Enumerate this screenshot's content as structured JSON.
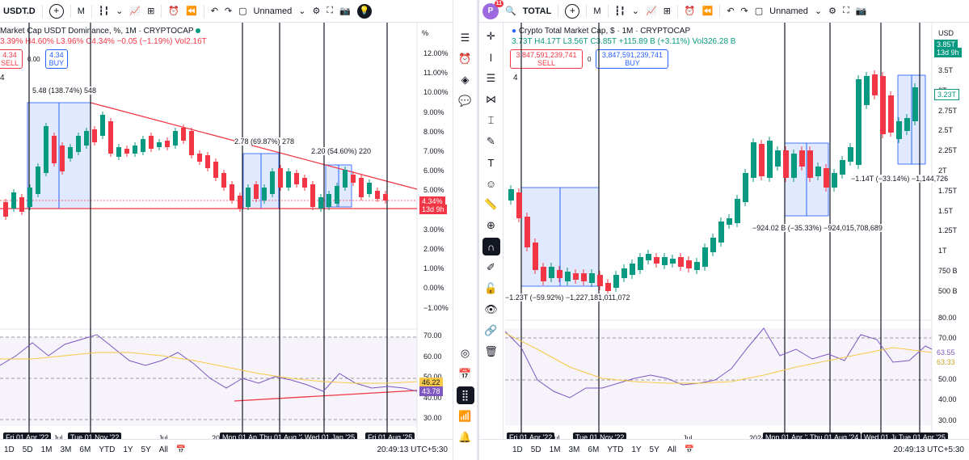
{
  "left": {
    "topbar": {
      "symbol": "USDT.D",
      "interval": "M",
      "layout_name": "Unnamed"
    },
    "legend": {
      "title": "Market Cap USDT Dominance, %",
      "interval": "1M",
      "exchange": "CRYPTOCAP",
      "values": [
        "3.39%",
        "H4.60%",
        "L3.96%",
        "C4.34%",
        "−0.05 (−1.19%)",
        "Vol2.16T"
      ]
    },
    "trade": {
      "sell_price": "4.34",
      "sell_label": "SELL",
      "spread": "0.00",
      "buy_price": "4.34",
      "buy_label": "BUY"
    },
    "indicator_count": "4",
    "price_axis_unit": "%",
    "price_axis": [
      "12.00%",
      "11.00%",
      "10.00%",
      "9.00%",
      "8.00%",
      "7.00%",
      "6.00%",
      "5.00%",
      "4.00%",
      "3.00%",
      "2.00%",
      "1.00%",
      "0.00%",
      "−1.00%"
    ],
    "current_price": "4.34%",
    "countdown": "13d 9h",
    "rsi_axis": [
      "70.00",
      "60.00",
      "50.00",
      "40.00",
      "30.00"
    ],
    "rsi_tags": {
      "ma": "46.22",
      "rsi": "43.78"
    },
    "measures": [
      {
        "label": "5.48 (138.74%) 548"
      },
      {
        "label": "2.78 (69.87%) 278"
      },
      {
        "label": "2.20 (54.60%) 220"
      }
    ],
    "time_labels": [
      "Jul",
      "Jul",
      "20"
    ],
    "time_pills": [
      "Fri 01 Apr '22",
      "Tue 01 Nov '22",
      "Mon 01 Apr",
      "Thu 01 Aug '2",
      "Wed 01 Jan '25",
      "Fri 01 Aug '25"
    ],
    "ranges": [
      "1D",
      "5D",
      "1M",
      "3M",
      "6M",
      "YTD",
      "1Y",
      "5Y",
      "All"
    ]
  },
  "right": {
    "topbar": {
      "avatar_letter": "P",
      "avatar_badge": "11",
      "symbol": "TOTAL",
      "interval": "M",
      "layout_name": "Unnamed"
    },
    "legend": {
      "title": "Crypto Total Market Cap, $",
      "interval": "1M",
      "exchange": "CRYPTOCAP",
      "values": [
        "3.73T",
        "H4.17T",
        "L3.56T",
        "C3.85T",
        "+115.89 B (+3.11%)",
        "Vol326.28 B"
      ]
    },
    "trade": {
      "sell_price": "3,847,591,239,741",
      "sell_label": "SELL",
      "spread": "0",
      "buy_price": "3,847,591,239,741",
      "buy_label": "BUY"
    },
    "indicator_count": "4",
    "price_axis_unit": "USD",
    "price_axis": [
      "3.5T",
      "3T",
      "2.75T",
      "2.5T",
      "2.25T",
      "2T",
      "1.75T",
      "1.5T",
      "1.25T",
      "1T",
      "750 B",
      "500 B"
    ],
    "current_price": "3.85T",
    "countdown": "13d 9h",
    "price_tag_2": "3.23T",
    "rsi_axis": [
      "80.00",
      "70.00",
      "60.00",
      "50.00",
      "40.00",
      "30.00"
    ],
    "rsi_tags": {
      "rsi": "63.55",
      "ma": "63.33"
    },
    "measures": [
      {
        "label": "−1.23T (−59.92%) −1,227,181,011,072"
      },
      {
        "label": "−924.02 B (−35.33%) −924,015,708,689"
      },
      {
        "label": "−1.14T (−33.14%) −1,144,726"
      }
    ],
    "time_labels": [
      "Jul",
      "Jul",
      "2024"
    ],
    "time_pills": [
      "Fri 01 Apr '22",
      "Tue 01 Nov '22",
      "Mon 01 Apr '2",
      "Thu 01 Aug '24",
      "Wed 01 Ja",
      "Tue 01 Apr '25"
    ],
    "ranges": [
      "1D",
      "5D",
      "1M",
      "3M",
      "6M",
      "YTD",
      "1Y",
      "5Y",
      "All"
    ]
  },
  "clock": "20:49:13 UTC+5:30",
  "colors": {
    "up": "#089981",
    "down": "#f23645",
    "measure": "#2962ff",
    "rsi": "#7e57c2",
    "rsi_ma": "#f7c948"
  }
}
